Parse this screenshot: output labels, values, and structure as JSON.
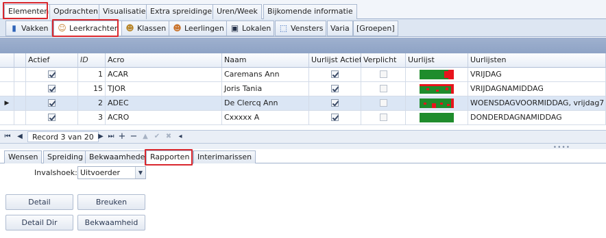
{
  "main_tabs": [
    {
      "label": "Elementen",
      "active": true
    },
    {
      "label": "Opdrachten"
    },
    {
      "label": "Visualisatie"
    },
    {
      "label": "Extra spreidingen"
    },
    {
      "label": "Uren/Week"
    },
    {
      "label": "Bijkomende informatie"
    }
  ],
  "sub_tabs": [
    {
      "label": "Vakken",
      "icon": "book-icon"
    },
    {
      "label": "Leerkrachten",
      "icon": "person-icon",
      "active": true
    },
    {
      "label": "Klassen",
      "icon": "group-icon"
    },
    {
      "label": "Leerlingen",
      "icon": "students-icon"
    },
    {
      "label": "Lokalen",
      "icon": "room-icon"
    },
    {
      "label": "Vensters",
      "icon": "window-icon"
    },
    {
      "label": "Varia"
    },
    {
      "label": "[Groepen]"
    }
  ],
  "grid": {
    "columns": [
      "Actief",
      "ID",
      "Acro",
      "Naam",
      "Uurlijst Actief",
      "Verplicht",
      "Uurlijst",
      "Uurlijsten"
    ],
    "rows": [
      {
        "actief": true,
        "id": "1",
        "acro": "ACAR",
        "naam": "Caremans Ann",
        "uurlijst_actief": true,
        "verplicht": false,
        "uurlijsten": "VRIJDAG"
      },
      {
        "actief": true,
        "id": "15",
        "acro": "TJOR",
        "naam": "Joris Tania",
        "uurlijst_actief": true,
        "verplicht": false,
        "uurlijsten": "VRIJDAGNAMIDDAG"
      },
      {
        "actief": true,
        "id": "2",
        "acro": "ADEC",
        "naam": "De Clercq Ann",
        "uurlijst_actief": true,
        "verplicht": false,
        "uurlijsten": "WOENSDAGVOORMIDDAG,   vrijdag7",
        "selected": true
      },
      {
        "actief": true,
        "id": "3",
        "acro": "ACRO",
        "naam": "Cxxxxx A",
        "uurlijst_actief": true,
        "verplicht": false,
        "uurlijsten": "DONDERDAGNAMIDDAG"
      }
    ],
    "colors": {
      "available": "#1f8c2c",
      "blocked": "#e8141c",
      "selected_row": "#dbe6f5"
    }
  },
  "navigator": {
    "record_label": "Record 3 van 20"
  },
  "bottom_tabs": [
    {
      "label": "Wensen"
    },
    {
      "label": "Spreiding"
    },
    {
      "label": "Bekwaamheden"
    },
    {
      "label": "Rapporten",
      "active": true
    },
    {
      "label": "Interimarissen"
    }
  ],
  "form": {
    "invalshoek_label": "Invalshoek:",
    "invalshoek_value": "Uitvoerder"
  },
  "buttons": {
    "detail": "Detail",
    "breuken": "Breuken",
    "detail_dir": "Detail Dir",
    "bekwaamheid": "Bekwaamheid"
  }
}
